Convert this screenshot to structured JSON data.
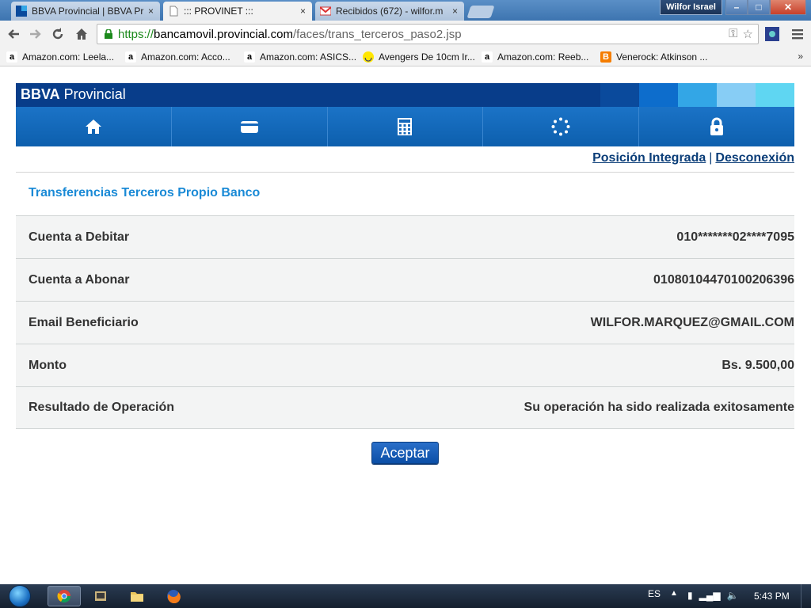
{
  "browser": {
    "tabs": [
      {
        "label": "BBVA Provincial | BBVA Pr",
        "close": "×",
        "icon": "bbva-favicon"
      },
      {
        "label": "::: PROVINET :::",
        "close": "×",
        "icon": "page-favicon"
      },
      {
        "label": "Recibidos (672) - wilfor.m",
        "close": "×",
        "icon": "gmail-favicon"
      }
    ],
    "user_name": "Wilfor Israel",
    "window_controls": {
      "minimize": "–",
      "maximize": "□",
      "close": "✕"
    },
    "url": {
      "scheme": "https://",
      "host": "bancamovil.provincial.com",
      "path": "/faces/trans_terceros_paso2.jsp"
    },
    "bookmarks": [
      {
        "label": "Amazon.com: Leela...",
        "icon": "amazon-icon"
      },
      {
        "label": "Amazon.com: Acco...",
        "icon": "amazon-icon"
      },
      {
        "label": "Amazon.com: ASICS...",
        "icon": "amazon-icon"
      },
      {
        "label": "Avengers De 10cm Ir...",
        "icon": "mercadolibre-icon"
      },
      {
        "label": "Amazon.com: Reeb...",
        "icon": "amazon-icon"
      },
      {
        "label": "Venerock: Atkinson ...",
        "icon": "blogger-icon"
      }
    ],
    "bookmarks_more": "»"
  },
  "bank": {
    "brand_bold": "BBVA",
    "brand_rest": " Provincial",
    "brand_blocks": [
      "#0a4a9c",
      "#0d6dcc",
      "#33a6e6",
      "#87cdf5",
      "#5fd6f2"
    ],
    "menu": [
      "home-icon",
      "card-icon",
      "calculator-icon",
      "loading-icon",
      "lock-icon"
    ],
    "links": {
      "position": "Posición Integrada",
      "separator": "|",
      "logout": "Desconexión"
    },
    "section_title": "Transferencias Terceros Propio Banco",
    "rows": [
      {
        "label": "Cuenta a Debitar",
        "value": "010*******02****7095"
      },
      {
        "label": "Cuenta a Abonar",
        "value": "01080104470100206396"
      },
      {
        "label": "Email Beneficiario",
        "value": "WILFOR.MARQUEZ@GMAIL.COM"
      },
      {
        "label": "Monto",
        "value": "Bs. 9.500,00"
      },
      {
        "label": "Resultado de Operación",
        "value": "Su operación ha sido realizada exitosamente"
      }
    ],
    "accept_label": "Aceptar"
  },
  "taskbar": {
    "language": "ES",
    "time": "5:43 PM",
    "apps": [
      "chrome-icon",
      "explorer-icon",
      "folder-icon",
      "firefox-icon"
    ]
  }
}
